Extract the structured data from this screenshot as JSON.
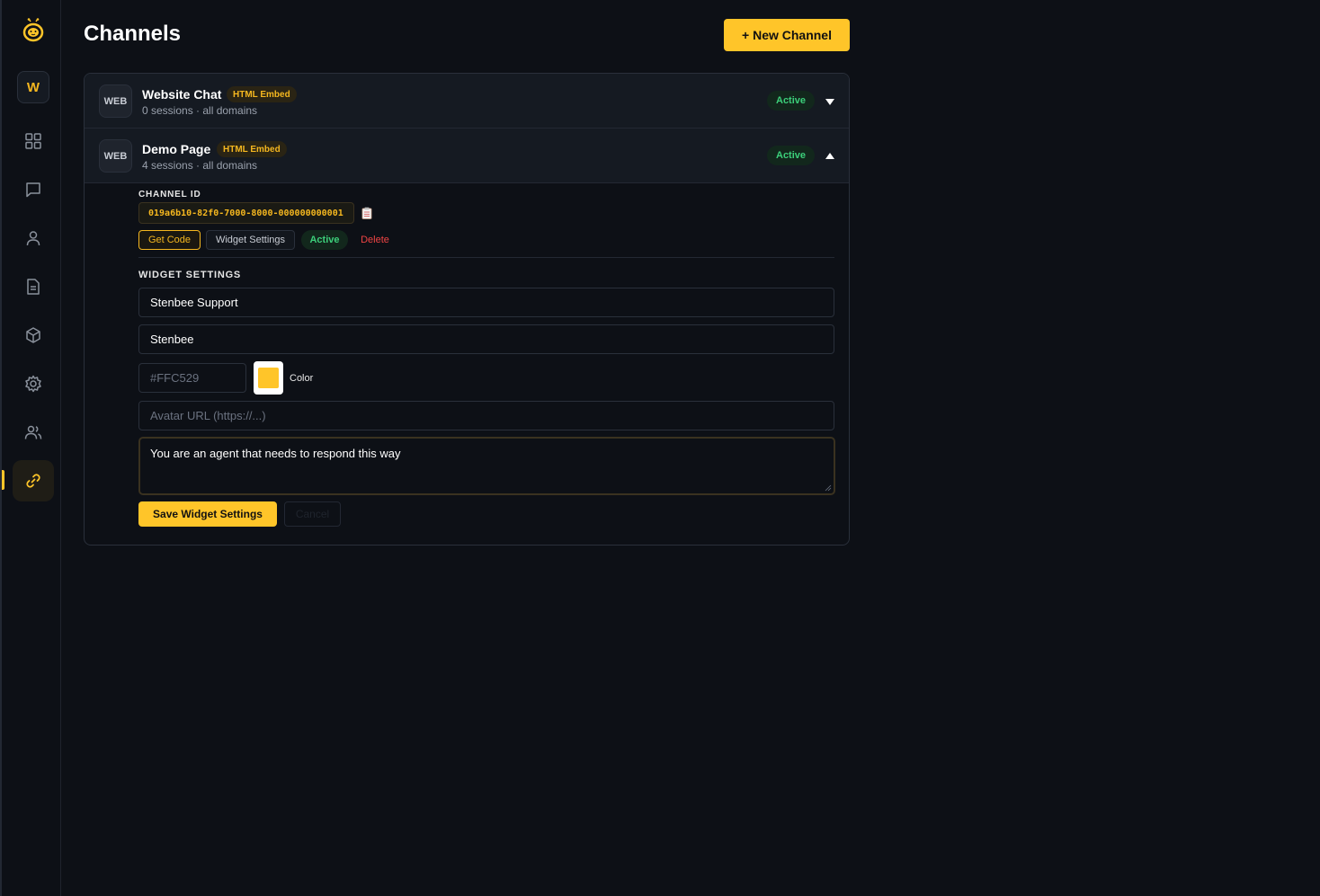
{
  "sidebar": {
    "logo_icon": "bee-logo-icon",
    "workspace_initial": "W",
    "nav_items": [
      {
        "icon": "grid-icon"
      },
      {
        "icon": "chat-icon"
      },
      {
        "icon": "user-icon"
      },
      {
        "icon": "document-icon"
      },
      {
        "icon": "cube-icon"
      },
      {
        "icon": "gear-icon"
      },
      {
        "icon": "users-icon"
      },
      {
        "icon": "link-icon",
        "active": true
      }
    ]
  },
  "header": {
    "title": "Channels",
    "new_button_label": "+ New Channel"
  },
  "channels": [
    {
      "type_badge": "WEB",
      "name": "Website Chat",
      "tag": "HTML Embed",
      "meta": "0 sessions · all domains",
      "status": "Active",
      "expanded": false
    },
    {
      "type_badge": "WEB",
      "name": "Demo Page",
      "tag": "HTML Embed",
      "meta": "4 sessions · all domains",
      "status": "Active",
      "expanded": true
    }
  ],
  "details": {
    "channel_id_label": "CHANNEL ID",
    "channel_id": "019a6b10-82f0-7000-8000-000000000001",
    "actions": {
      "get_code": "Get Code",
      "widget_settings": "Widget Settings",
      "active": "Active",
      "delete": "Delete"
    },
    "widget_settings_label": "WIDGET SETTINGS",
    "widget_title_value": "Stenbee Support",
    "bot_name_value": "Stenbee",
    "color_placeholder": "#FFC529",
    "color_value": "#FFC529",
    "color_label": "Color",
    "avatar_placeholder": "Avatar URL (https://...)",
    "prompt_value": "You are an agent that needs to respond this way",
    "save_label": "Save Widget Settings",
    "cancel_label": "Cancel"
  },
  "colors": {
    "accent": "#FFC529",
    "active_green": "#3CCF7A",
    "danger": "#EF4444",
    "background": "#0D1016"
  }
}
